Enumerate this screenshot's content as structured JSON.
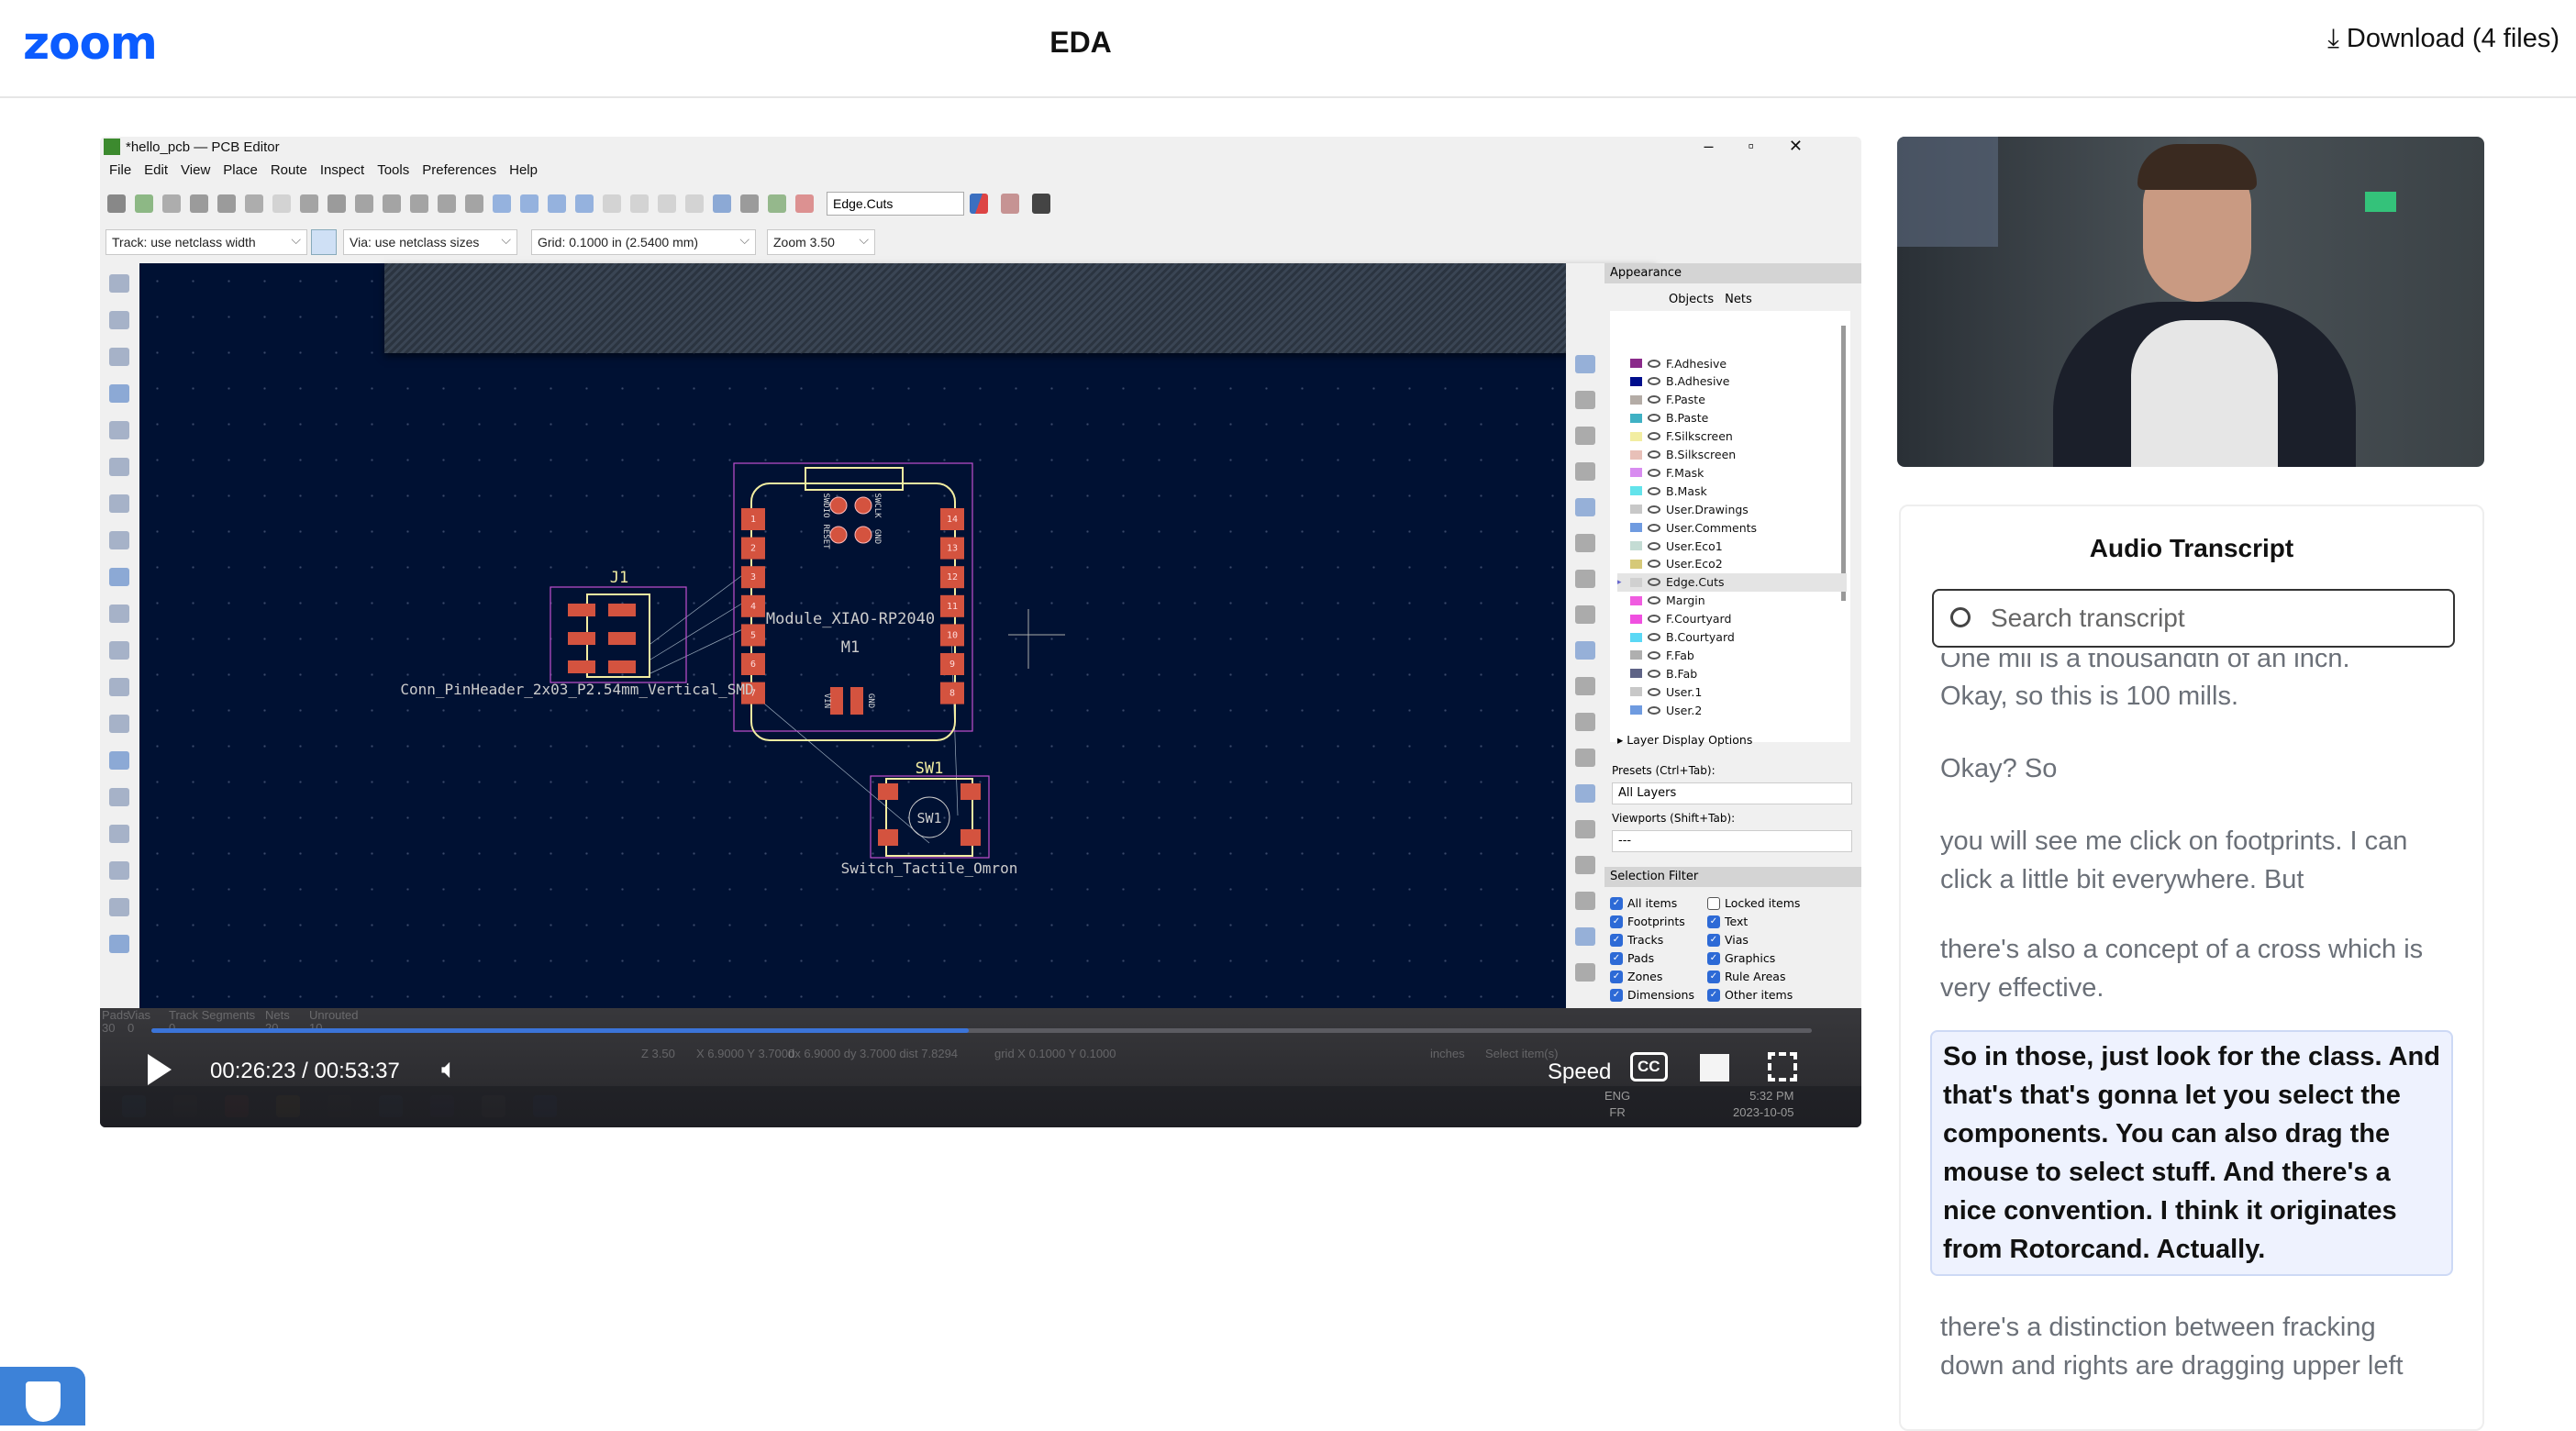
{
  "header": {
    "logo": "zoom",
    "title": "EDA",
    "download": "Download (4 files)",
    "download_icon": "download-arrow-icon"
  },
  "kicad": {
    "window_title": "*hello_pcb — PCB Editor",
    "menu": [
      "File",
      "Edit",
      "View",
      "Place",
      "Route",
      "Inspect",
      "Tools",
      "Preferences",
      "Help"
    ],
    "layer_select": "Edge.Cuts",
    "track": "Track: use netclass width",
    "via": "Via: use netclass sizes",
    "grid": "Grid: 0.1000 in (2.5400 mm)",
    "zoom": "Zoom 3.50",
    "pcb": {
      "j1_ref": "J1",
      "j1_value": "Conn_PinHeader_2x03_P2.54mm_Vertical_SMD",
      "m1_value": "Module_XIAO-RP2040",
      "m1_ref": "M1",
      "sw1_ref": "SW1",
      "sw1_value": "Switch_Tactile_Omron",
      "m1_pads_left": [
        "1",
        "2",
        "3",
        "4",
        "5",
        "6",
        "7"
      ],
      "m1_pads_right": [
        "14",
        "13",
        "12",
        "11",
        "10",
        "9",
        "8"
      ],
      "m1_labels": [
        "SWDIO",
        "SWCLK",
        "RESET",
        "GND",
        "VIN",
        "GND"
      ]
    },
    "appearance": {
      "title": "Appearance",
      "tabs": [
        "Objects",
        "Nets"
      ],
      "layers": [
        {
          "name": "F.Adhesive",
          "color": "#8a2a8a"
        },
        {
          "name": "B.Adhesive",
          "color": "#000e8c"
        },
        {
          "name": "F.Paste",
          "color": "#b4aca6"
        },
        {
          "name": "B.Paste",
          "color": "#3fb1c4"
        },
        {
          "name": "F.Silkscreen",
          "color": "#f2eda1"
        },
        {
          "name": "B.Silkscreen",
          "color": "#e8c0b8"
        },
        {
          "name": "F.Mask",
          "color": "#d88cf0"
        },
        {
          "name": "B.Mask",
          "color": "#63e3eb"
        },
        {
          "name": "User.Drawings",
          "color": "#c8c8c8"
        },
        {
          "name": "User.Comments",
          "color": "#6f9be0"
        },
        {
          "name": "User.Eco1",
          "color": "#c4dcd4"
        },
        {
          "name": "User.Eco2",
          "color": "#d6c978"
        },
        {
          "name": "Edge.Cuts",
          "color": "#d0d0d0"
        },
        {
          "name": "Margin",
          "color": "#f05ce0"
        },
        {
          "name": "F.Courtyard",
          "color": "#f050e0"
        },
        {
          "name": "B.Courtyard",
          "color": "#5ad8f5"
        },
        {
          "name": "F.Fab",
          "color": "#afafaf"
        },
        {
          "name": "B.Fab",
          "color": "#5e6386"
        },
        {
          "name": "User.1",
          "color": "#c8c8c8"
        },
        {
          "name": "User.2",
          "color": "#6f9be0"
        }
      ],
      "selected_layer": "Edge.Cuts",
      "layer_display_options": "Layer Display Options",
      "presets_label": "Presets (Ctrl+Tab):",
      "presets_value": "All Layers",
      "viewports_label": "Viewports (Shift+Tab):",
      "viewports_value": "---",
      "selection_filter": "Selection Filter",
      "filters": [
        {
          "label": "All items",
          "checked": true
        },
        {
          "label": "Locked items",
          "checked": false
        },
        {
          "label": "Footprints",
          "checked": true
        },
        {
          "label": "Text",
          "checked": true
        },
        {
          "label": "Tracks",
          "checked": true
        },
        {
          "label": "Vias",
          "checked": true
        },
        {
          "label": "Pads",
          "checked": true
        },
        {
          "label": "Graphics",
          "checked": true
        },
        {
          "label": "Zones",
          "checked": true
        },
        {
          "label": "Rule Areas",
          "checked": true
        },
        {
          "label": "Dimensions",
          "checked": true
        },
        {
          "label": "Other items",
          "checked": true
        }
      ]
    },
    "status": {
      "headers": [
        "Pads",
        "Vias",
        "Track Segments",
        "Nets",
        "Unrouted"
      ],
      "values": [
        "30",
        "0",
        "0",
        "20",
        "10"
      ],
      "readout": [
        "Z 3.50",
        "X 6.9000  Y 3.7000",
        "dx 6.9000  dy 3.7000  dist 7.8294",
        "grid X 0.1000  Y 0.1000",
        "inches",
        "Select item(s)"
      ]
    },
    "taskbar": {
      "lang1": "ENG",
      "lang2": "FR",
      "time": "5:32 PM",
      "date": "2023-10-05"
    }
  },
  "player": {
    "current": "00:26:23",
    "separator": "/",
    "duration": "00:53:37",
    "progress": 0.492,
    "speed": "Speed",
    "cc": "CC"
  },
  "transcript": {
    "title": "Audio Transcript",
    "search_placeholder": "Search transcript",
    "entries": [
      "One mil is a thousandth of an inch.",
      "Okay, so this is 100 mills.",
      "Okay? So",
      "you will see me click on footprints. I can click a little bit everywhere. But",
      "there's also a concept of a cross which is very effective.",
      "So in those, just look for the class. And that's that's gonna let you select the components. You can also drag the mouse to select stuff. And there's a nice convention. I think it originates from Rotorcand. Actually.",
      "there's a distinction between fracking down and rights are dragging upper left"
    ],
    "current_index": 5
  },
  "colors": {
    "accent": "#0b5cff",
    "progress": "#3b74d9",
    "pad": "#d4533f",
    "courtyard": "#c04fd0",
    "silk": "#f2eda1",
    "canvas": "#001133"
  }
}
